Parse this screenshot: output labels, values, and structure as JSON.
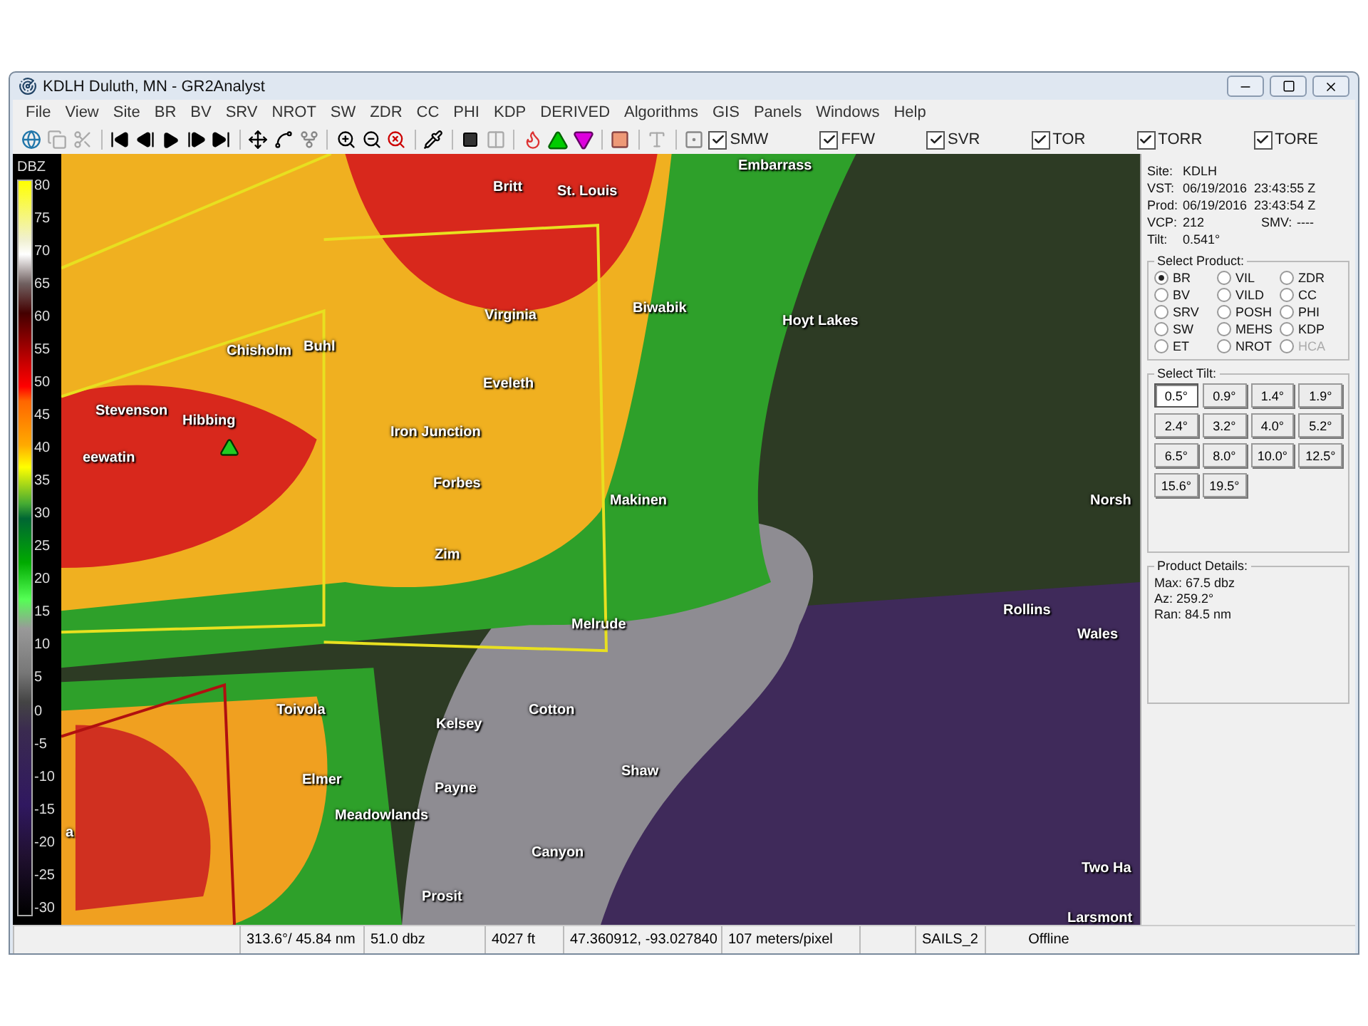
{
  "window": {
    "title": "KDLH Duluth, MN - GR2Analyst"
  },
  "menu": [
    "File",
    "View",
    "Site",
    "BR",
    "BV",
    "SRV",
    "NROT",
    "SW",
    "ZDR",
    "CC",
    "PHI",
    "KDP",
    "DERIVED",
    "Algorithms",
    "GIS",
    "Panels",
    "Windows",
    "Help"
  ],
  "warning_filters": [
    {
      "label": "SMW",
      "checked": true
    },
    {
      "label": "FFW",
      "checked": true
    },
    {
      "label": "SVR",
      "checked": true
    },
    {
      "label": "TOR",
      "checked": true
    },
    {
      "label": "TORR",
      "checked": true
    },
    {
      "label": "TORE",
      "checked": true
    }
  ],
  "color_scale": {
    "unit": "DBZ",
    "ticks": [
      "80",
      "75",
      "70",
      "65",
      "60",
      "55",
      "50",
      "45",
      "40",
      "35",
      "30",
      "25",
      "20",
      "15",
      "10",
      "5",
      "0",
      "-5",
      "-10",
      "-15",
      "-20",
      "-25",
      "-30"
    ]
  },
  "map": {
    "places": [
      "Britt",
      "St. Louis",
      "Embarrass",
      "Virginia",
      "Biwabik",
      "Hoyt Lakes",
      "Chisholm",
      "Buhl",
      "Stevenson",
      "Hibbing",
      "Eveleth",
      "eewatin",
      "Iron Junction",
      "Forbes",
      "Makinen",
      "Norsh",
      "Zim",
      "Melrude",
      "Rollins",
      "Wales",
      "Toivola",
      "Kelsey",
      "Cotton",
      "Shaw",
      "Elmer",
      "Payne",
      "Meadowlands",
      "a",
      "Canyon",
      "Prosit",
      "Two Ha",
      "Larsmont"
    ]
  },
  "info": [
    {
      "label": "Site:",
      "value": "KDLH"
    },
    {
      "label": "VST:",
      "value": "06/19/2016  23:43:55 Z"
    },
    {
      "label": "Prod:",
      "value": "06/19/2016  23:43:54 Z"
    },
    {
      "label": "VCP:",
      "value": "212",
      "extra_label": "SMV:",
      "extra_value": "----"
    },
    {
      "label": "Tilt:",
      "value": "0.541°"
    }
  ],
  "select_product": {
    "title": "Select Product:",
    "options": [
      {
        "label": "BR",
        "selected": true,
        "disabled": false
      },
      {
        "label": "VIL",
        "selected": false,
        "disabled": false
      },
      {
        "label": "ZDR",
        "selected": false,
        "disabled": false
      },
      {
        "label": "BV",
        "selected": false,
        "disabled": false
      },
      {
        "label": "VILD",
        "selected": false,
        "disabled": false
      },
      {
        "label": "CC",
        "selected": false,
        "disabled": false
      },
      {
        "label": "SRV",
        "selected": false,
        "disabled": false
      },
      {
        "label": "POSH",
        "selected": false,
        "disabled": false
      },
      {
        "label": "PHI",
        "selected": false,
        "disabled": false
      },
      {
        "label": "SW",
        "selected": false,
        "disabled": false
      },
      {
        "label": "MEHS",
        "selected": false,
        "disabled": false
      },
      {
        "label": "KDP",
        "selected": false,
        "disabled": false
      },
      {
        "label": "ET",
        "selected": false,
        "disabled": false
      },
      {
        "label": "NROT",
        "selected": false,
        "disabled": false
      },
      {
        "label": "HCA",
        "selected": false,
        "disabled": true
      }
    ]
  },
  "select_tilt": {
    "title": "Select Tilt:",
    "tilts": [
      {
        "label": "0.5°",
        "selected": true
      },
      {
        "label": "0.9°",
        "selected": false
      },
      {
        "label": "1.4°",
        "selected": false
      },
      {
        "label": "1.9°",
        "selected": false
      },
      {
        "label": "2.4°",
        "selected": false
      },
      {
        "label": "3.2°",
        "selected": false
      },
      {
        "label": "4.0°",
        "selected": false
      },
      {
        "label": "5.2°",
        "selected": false
      },
      {
        "label": "6.5°",
        "selected": false
      },
      {
        "label": "8.0°",
        "selected": false
      },
      {
        "label": "10.0°",
        "selected": false
      },
      {
        "label": "12.5°",
        "selected": false
      },
      {
        "label": "15.6°",
        "selected": false
      },
      {
        "label": "19.5°",
        "selected": false
      }
    ]
  },
  "product_details": {
    "title": "Product Details:",
    "lines": [
      "Max:  67.5 dbz",
      "Az:  259.2°",
      "Ran:  84.5 nm"
    ]
  },
  "status_bar": {
    "position": "313.6°/ 45.84 nm",
    "value": "51.0 dbz",
    "height": "4027 ft",
    "coordinates": "47.360912, -93.027840",
    "scale": "107 meters/pixel",
    "mode": "SAILS_2",
    "connection": "Offline"
  }
}
